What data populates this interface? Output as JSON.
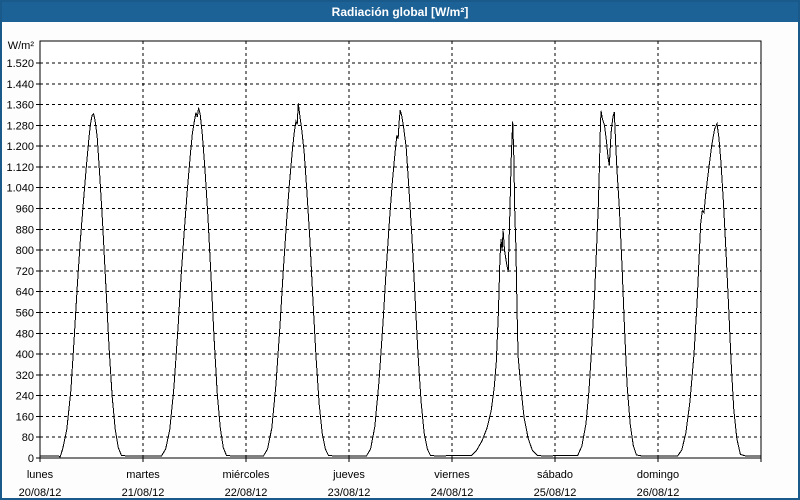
{
  "window": {
    "title": "Radiación global [W/m²]"
  },
  "colors": {
    "title_bar_bg": "#1d6296",
    "title_text": "#ffffff",
    "window_border": "#1a5a8a",
    "background": "#fdfdfd",
    "plot_bg": "#ffffff",
    "chart_line": "#000000",
    "grid": "#000000",
    "axis_text": "#000000"
  },
  "chart_data": {
    "type": "line",
    "title": "Radiación global [W/m²]",
    "ylabel": "W/m²",
    "xlabel": "",
    "grid": "dashed horizontal and vertical (day boundaries)",
    "legend": "none",
    "ylim": [
      0,
      1600
    ],
    "x_range_days": [
      0,
      7
    ],
    "y_ticks": [
      0,
      80,
      160,
      240,
      320,
      400,
      480,
      560,
      640,
      720,
      800,
      880,
      960,
      1040,
      1120,
      1200,
      1280,
      1360,
      1440,
      1520
    ],
    "y_tick_labels": [
      "0",
      "80",
      "160",
      "240",
      "320",
      "400",
      "480",
      "560",
      "640",
      "720",
      "800",
      "880",
      "960",
      "1.040",
      "1.120",
      "1.200",
      "1.280",
      "1.360",
      "1.440",
      "1.520"
    ],
    "x_days": [
      {
        "name": "lunes",
        "date": "20/08/12"
      },
      {
        "name": "martes",
        "date": "21/08/12"
      },
      {
        "name": "miércoles",
        "date": "22/08/12"
      },
      {
        "name": "jueves",
        "date": "23/08/12"
      },
      {
        "name": "viernes",
        "date": "24/08/12"
      },
      {
        "name": "sábado",
        "date": "25/08/12"
      },
      {
        "name": "domingo",
        "date": "26/08/12"
      }
    ],
    "series": [
      {
        "name": "Radiación global",
        "unit": "W/m²",
        "points": [
          [
            0.0,
            8
          ],
          [
            0.18,
            8
          ],
          [
            0.195,
            4
          ],
          [
            0.22,
            35
          ],
          [
            0.26,
            110
          ],
          [
            0.3,
            260
          ],
          [
            0.33,
            450
          ],
          [
            0.36,
            650
          ],
          [
            0.39,
            830
          ],
          [
            0.42,
            980
          ],
          [
            0.45,
            1120
          ],
          [
            0.475,
            1230
          ],
          [
            0.49,
            1285
          ],
          [
            0.505,
            1318
          ],
          [
            0.52,
            1325
          ],
          [
            0.535,
            1298
          ],
          [
            0.555,
            1235
          ],
          [
            0.58,
            1090
          ],
          [
            0.61,
            890
          ],
          [
            0.64,
            660
          ],
          [
            0.67,
            430
          ],
          [
            0.7,
            240
          ],
          [
            0.73,
            110
          ],
          [
            0.76,
            40
          ],
          [
            0.79,
            10
          ],
          [
            0.84,
            8
          ],
          [
            1.18,
            8
          ],
          [
            1.22,
            35
          ],
          [
            1.26,
            110
          ],
          [
            1.3,
            270
          ],
          [
            1.34,
            500
          ],
          [
            1.37,
            700
          ],
          [
            1.4,
            870
          ],
          [
            1.43,
            1030
          ],
          [
            1.46,
            1170
          ],
          [
            1.48,
            1250
          ],
          [
            1.5,
            1300
          ],
          [
            1.515,
            1330
          ],
          [
            1.527,
            1312
          ],
          [
            1.54,
            1348
          ],
          [
            1.555,
            1322
          ],
          [
            1.575,
            1250
          ],
          [
            1.6,
            1120
          ],
          [
            1.63,
            930
          ],
          [
            1.66,
            700
          ],
          [
            1.69,
            460
          ],
          [
            1.72,
            250
          ],
          [
            1.75,
            115
          ],
          [
            1.78,
            40
          ],
          [
            1.81,
            10
          ],
          [
            1.86,
            8
          ],
          [
            2.17,
            8
          ],
          [
            2.21,
            35
          ],
          [
            2.25,
            115
          ],
          [
            2.29,
            280
          ],
          [
            2.33,
            510
          ],
          [
            2.36,
            710
          ],
          [
            2.39,
            890
          ],
          [
            2.42,
            1050
          ],
          [
            2.45,
            1185
          ],
          [
            2.47,
            1258
          ],
          [
            2.485,
            1296
          ],
          [
            2.497,
            1284
          ],
          [
            2.508,
            1365
          ],
          [
            2.522,
            1318
          ],
          [
            2.54,
            1268
          ],
          [
            2.565,
            1175
          ],
          [
            2.59,
            1030
          ],
          [
            2.62,
            840
          ],
          [
            2.65,
            610
          ],
          [
            2.68,
            390
          ],
          [
            2.71,
            210
          ],
          [
            2.74,
            95
          ],
          [
            2.77,
            35
          ],
          [
            2.8,
            10
          ],
          [
            2.85,
            8
          ],
          [
            3.17,
            8
          ],
          [
            3.21,
            35
          ],
          [
            3.25,
            120
          ],
          [
            3.29,
            290
          ],
          [
            3.33,
            520
          ],
          [
            3.36,
            720
          ],
          [
            3.39,
            900
          ],
          [
            3.42,
            1060
          ],
          [
            3.45,
            1190
          ],
          [
            3.465,
            1242
          ],
          [
            3.477,
            1228
          ],
          [
            3.488,
            1302
          ],
          [
            3.497,
            1338
          ],
          [
            3.512,
            1318
          ],
          [
            3.53,
            1272
          ],
          [
            3.555,
            1195
          ],
          [
            3.58,
            1050
          ],
          [
            3.61,
            860
          ],
          [
            3.64,
            630
          ],
          [
            3.67,
            400
          ],
          [
            3.7,
            215
          ],
          [
            3.73,
            95
          ],
          [
            3.76,
            35
          ],
          [
            3.79,
            10
          ],
          [
            3.84,
            8
          ],
          [
            4.19,
            10
          ],
          [
            4.24,
            30
          ],
          [
            4.29,
            65
          ],
          [
            4.34,
            115
          ],
          [
            4.38,
            180
          ],
          [
            4.41,
            270
          ],
          [
            4.43,
            370
          ],
          [
            4.45,
            560
          ],
          [
            4.465,
            762
          ],
          [
            4.476,
            842
          ],
          [
            4.486,
            796
          ],
          [
            4.496,
            876
          ],
          [
            4.51,
            800
          ],
          [
            4.53,
            748
          ],
          [
            4.546,
            716
          ],
          [
            4.56,
            920
          ],
          [
            4.575,
            1150
          ],
          [
            4.589,
            1295
          ],
          [
            4.6,
            1160
          ],
          [
            4.61,
            940
          ],
          [
            4.62,
            812
          ],
          [
            4.632,
            560
          ],
          [
            4.642,
            392
          ],
          [
            4.67,
            265
          ],
          [
            4.7,
            155
          ],
          [
            4.74,
            75
          ],
          [
            4.78,
            30
          ],
          [
            4.83,
            10
          ],
          [
            4.88,
            8
          ],
          [
            5.22,
            10
          ],
          [
            5.26,
            45
          ],
          [
            5.3,
            130
          ],
          [
            5.33,
            260
          ],
          [
            5.36,
            450
          ],
          [
            5.385,
            640
          ],
          [
            5.405,
            820
          ],
          [
            5.42,
            970
          ],
          [
            5.432,
            1130
          ],
          [
            5.44,
            1262
          ],
          [
            5.447,
            1336
          ],
          [
            5.462,
            1302
          ],
          [
            5.48,
            1282
          ],
          [
            5.5,
            1218
          ],
          [
            5.515,
            1158
          ],
          [
            5.527,
            1125
          ],
          [
            5.545,
            1252
          ],
          [
            5.562,
            1312
          ],
          [
            5.576,
            1332
          ],
          [
            5.59,
            1198
          ],
          [
            5.602,
            1108
          ],
          [
            5.625,
            958
          ],
          [
            5.65,
            740
          ],
          [
            5.675,
            500
          ],
          [
            5.7,
            280
          ],
          [
            5.73,
            130
          ],
          [
            5.76,
            48
          ],
          [
            5.79,
            12
          ],
          [
            5.84,
            8
          ],
          [
            6.19,
            8
          ],
          [
            6.23,
            30
          ],
          [
            6.27,
            95
          ],
          [
            6.31,
            215
          ],
          [
            6.35,
            400
          ],
          [
            6.38,
            600
          ],
          [
            6.4,
            780
          ],
          [
            6.415,
            902
          ],
          [
            6.43,
            952
          ],
          [
            6.447,
            944
          ],
          [
            6.462,
            1012
          ],
          [
            6.49,
            1105
          ],
          [
            6.52,
            1200
          ],
          [
            6.55,
            1266
          ],
          [
            6.573,
            1286
          ],
          [
            6.59,
            1236
          ],
          [
            6.612,
            1136
          ],
          [
            6.635,
            986
          ],
          [
            6.66,
            795
          ],
          [
            6.685,
            585
          ],
          [
            6.71,
            370
          ],
          [
            6.735,
            190
          ],
          [
            6.765,
            75
          ],
          [
            6.8,
            14
          ],
          [
            6.85,
            8
          ],
          [
            7.0,
            8
          ]
        ]
      }
    ]
  }
}
